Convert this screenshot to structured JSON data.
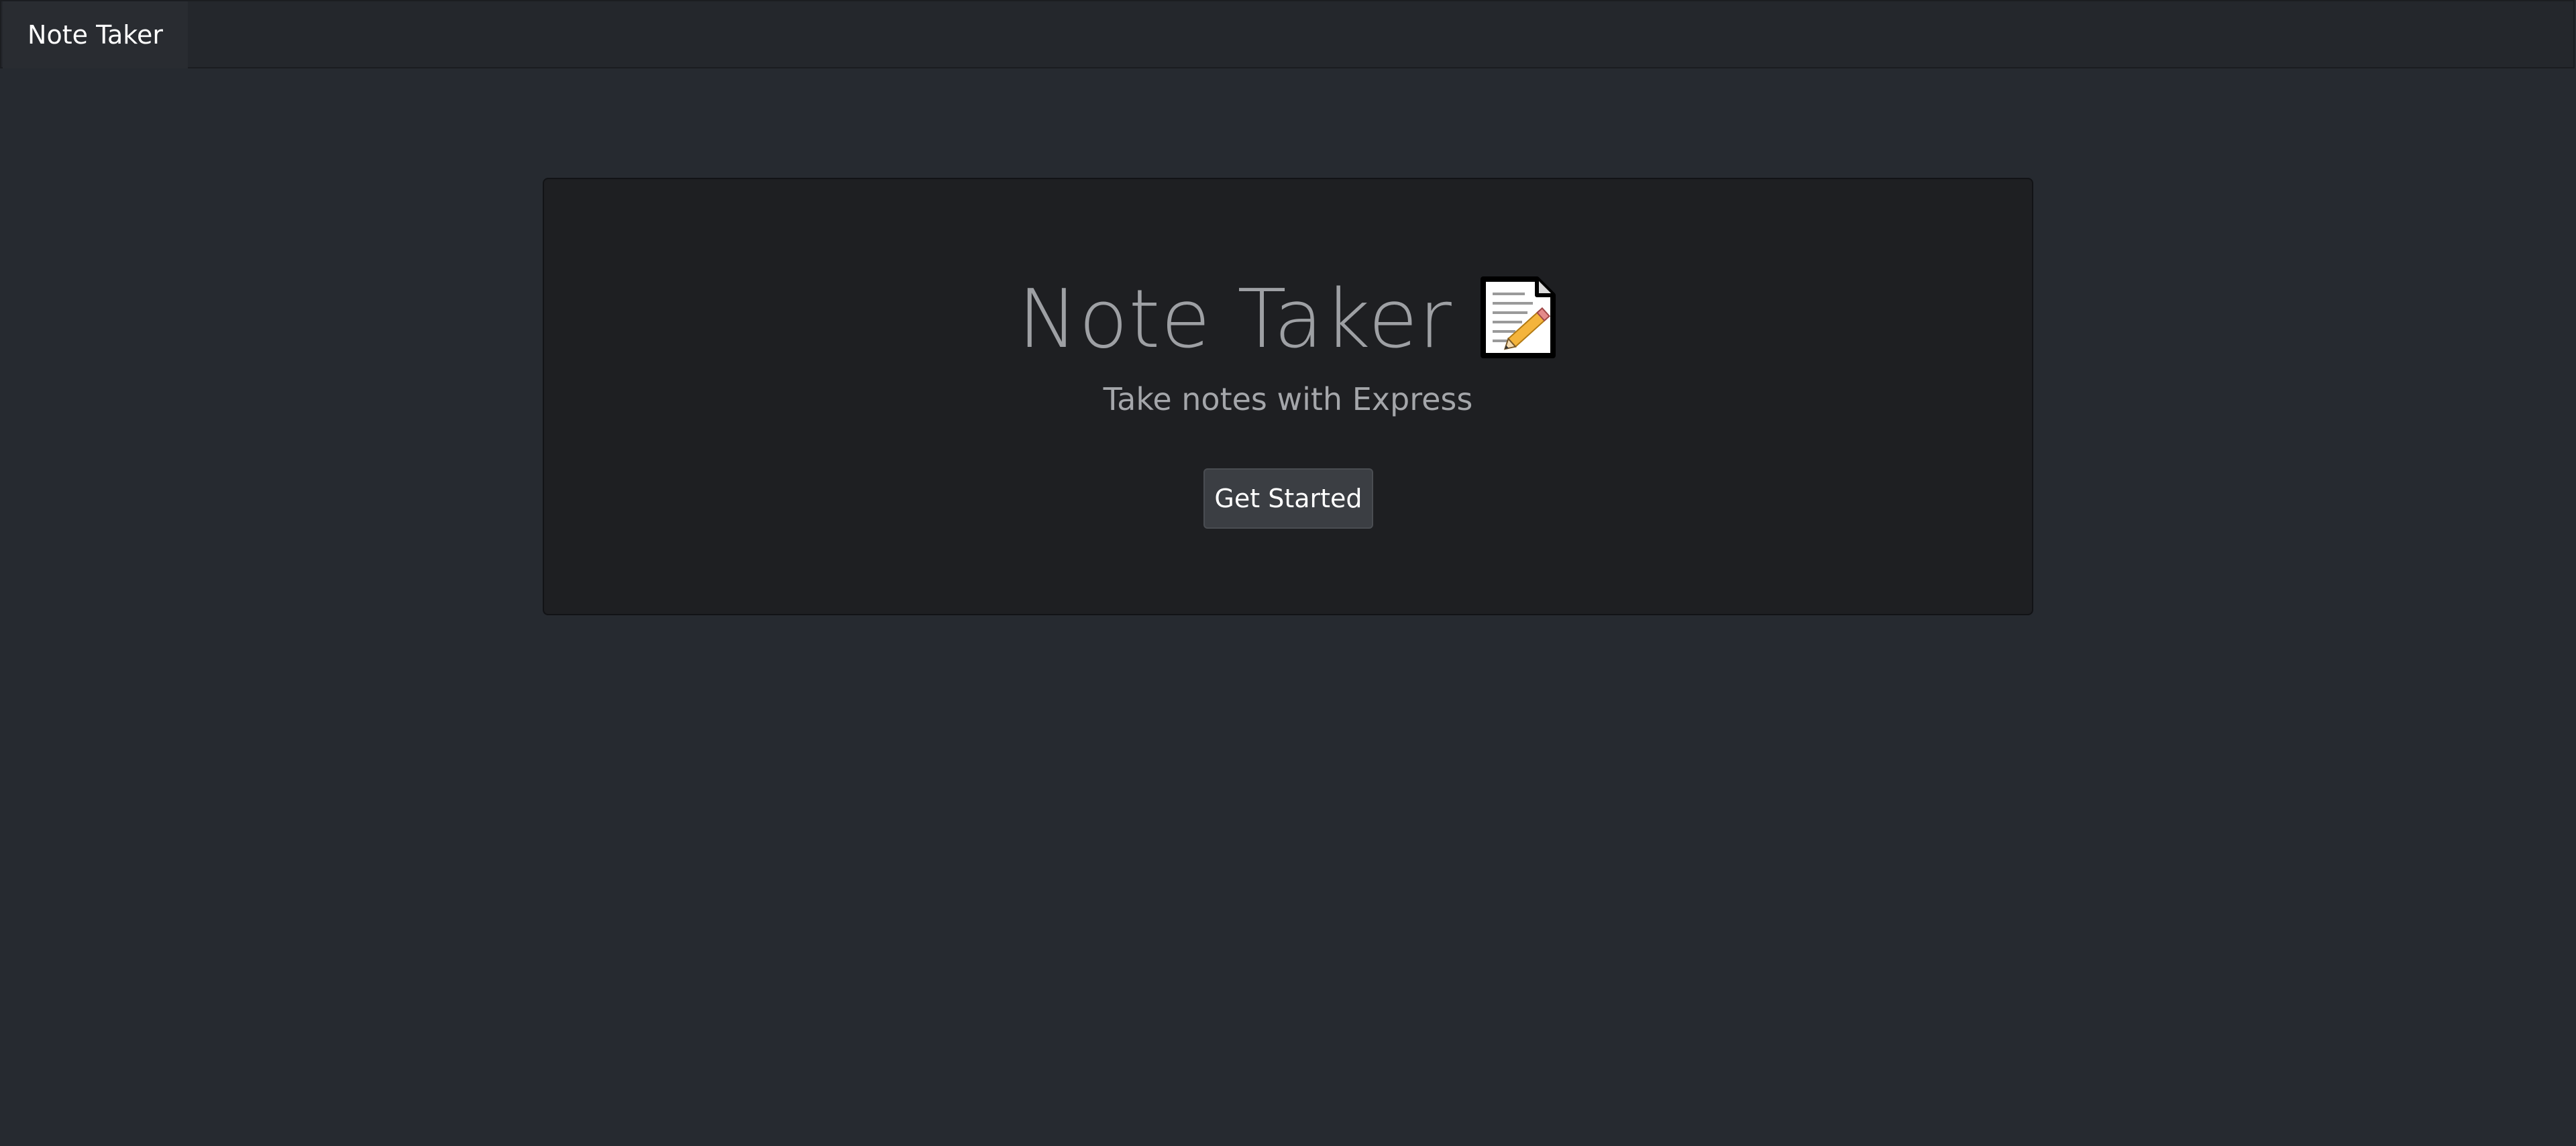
{
  "navbar": {
    "brand": "Note Taker"
  },
  "jumbotron": {
    "title": "Note Taker",
    "title_icon": "memo-icon",
    "subtitle": "Take notes with Express",
    "cta_label": "Get Started"
  },
  "colors": {
    "page_background": "#262a30",
    "navbar_background": "#24272c",
    "jumbotron_background": "#1e1f22",
    "button_background": "#3b3e43",
    "title_text": "#9ea0a4"
  }
}
